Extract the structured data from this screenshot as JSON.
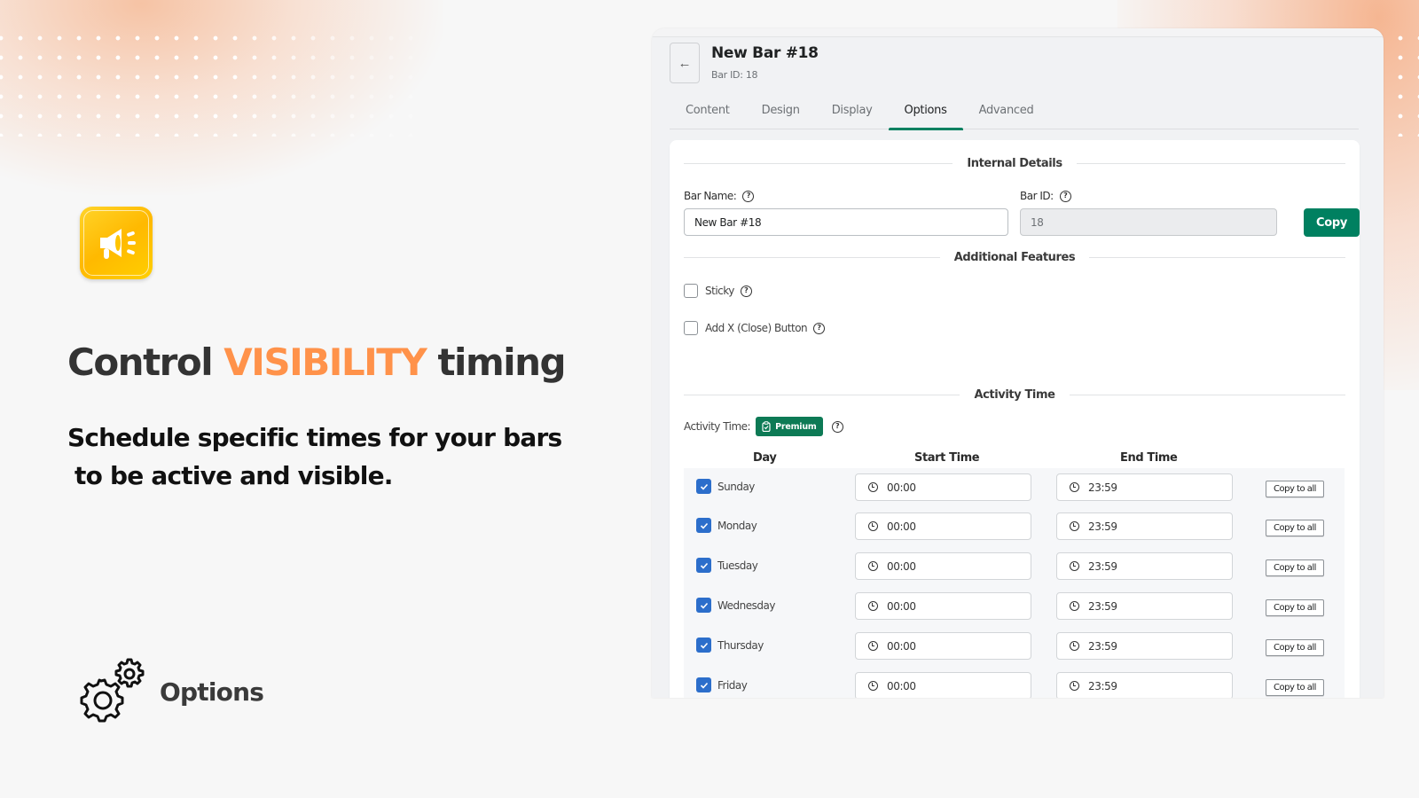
{
  "promo": {
    "headline_pre": "Control ",
    "headline_accent": "VISIBILITY",
    "headline_post": " timing",
    "subhead_line1": "Schedule specific times for your bars",
    "subhead_line2": "to be active and visible.",
    "feature_label": "Options",
    "accent_color": "#ff924a",
    "logo_icon": "megaphone-icon",
    "feature_icon": "gears-icon"
  },
  "app": {
    "back_icon": "arrow-left-icon",
    "title": "New Bar #18",
    "subtitle": "Bar ID: 18",
    "tabs": [
      {
        "label": "Content",
        "active": false
      },
      {
        "label": "Design",
        "active": false
      },
      {
        "label": "Display",
        "active": false
      },
      {
        "label": "Options",
        "active": true
      },
      {
        "label": "Advanced",
        "active": false
      }
    ],
    "accent_color": "#008060"
  },
  "internal_details": {
    "title": "Internal Details",
    "bar_name_label": "Bar Name:",
    "bar_name_value": "New Bar #18",
    "bar_id_label": "Bar ID:",
    "bar_id_value": "18",
    "copy_label": "Copy"
  },
  "additional_features": {
    "title": "Additional Features",
    "sticky_label": "Sticky",
    "sticky_checked": false,
    "close_button_label": "Add X (Close) Button",
    "close_button_checked": false
  },
  "activity_time": {
    "title": "Activity Time",
    "label": "Activity Time:",
    "badge": "Premium",
    "columns": {
      "day": "Day",
      "start": "Start Time",
      "end": "End Time"
    },
    "copy_to_all_label": "Copy to all",
    "rows": [
      {
        "day": "Sunday",
        "checked": true,
        "start": "00:00",
        "end": "23:59"
      },
      {
        "day": "Monday",
        "checked": true,
        "start": "00:00",
        "end": "23:59"
      },
      {
        "day": "Tuesday",
        "checked": true,
        "start": "00:00",
        "end": "23:59"
      },
      {
        "day": "Wednesday",
        "checked": true,
        "start": "00:00",
        "end": "23:59"
      },
      {
        "day": "Thursday",
        "checked": true,
        "start": "00:00",
        "end": "23:59"
      },
      {
        "day": "Friday",
        "checked": true,
        "start": "00:00",
        "end": "23:59"
      }
    ]
  }
}
